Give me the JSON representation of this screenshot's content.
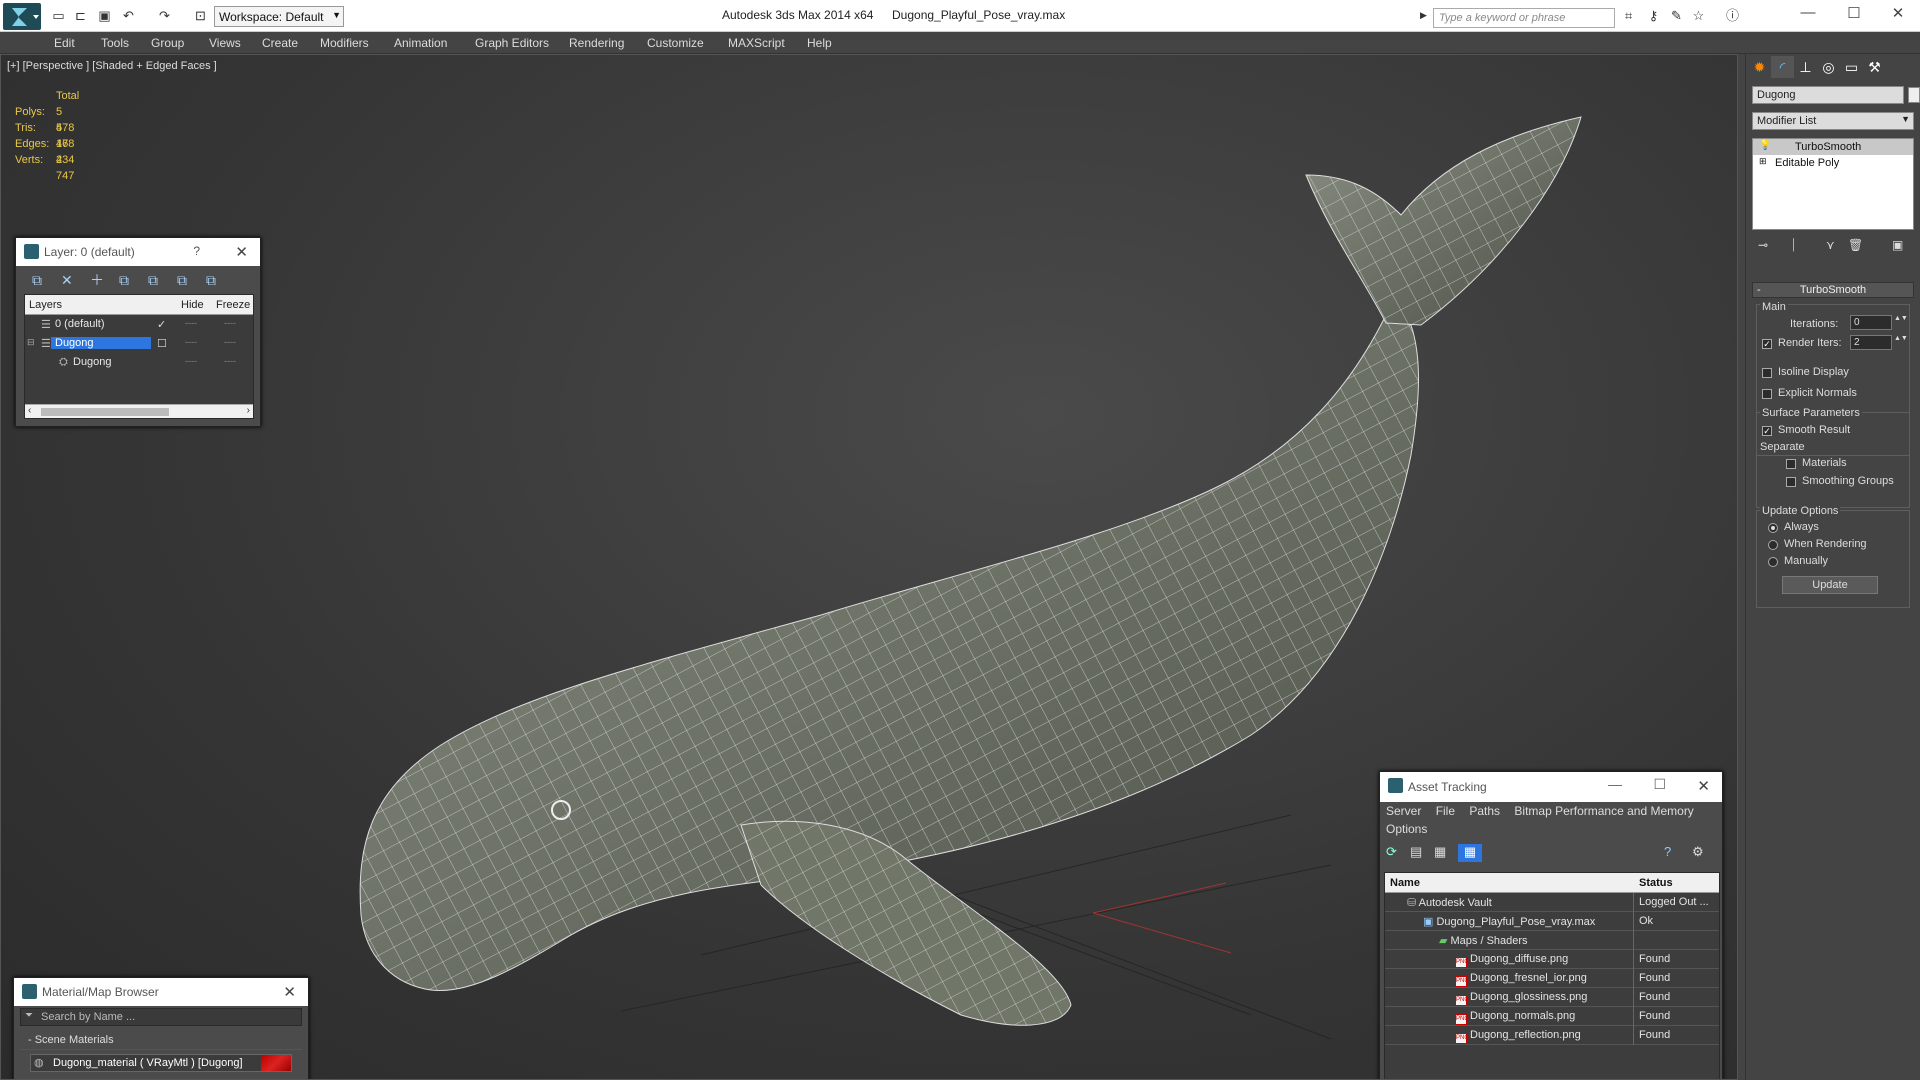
{
  "titlebar": {
    "app_title": "Autodesk 3ds Max  2014 x64",
    "file_title": "Dugong_Playful_Pose_vray.max",
    "workspace_label": "Workspace: Default",
    "search_placeholder": "Type a keyword or phrase"
  },
  "menus": [
    "Edit",
    "Tools",
    "Group",
    "Views",
    "Create",
    "Modifiers",
    "Animation",
    "Graph Editors",
    "Rendering",
    "Customize",
    "MAXScript",
    "Help"
  ],
  "viewport": {
    "label": "[+] [Perspective ] [Shaded + Edged Faces ]",
    "stats": {
      "header": "Total",
      "polys_label": "Polys:",
      "polys": "5 478",
      "tris_label": "Tris:",
      "tris": "5 478",
      "edges_label": "Edges:",
      "edges": "16 434",
      "verts_label": "Verts:",
      "verts": "2 747"
    }
  },
  "layer_panel": {
    "title": "Layer: 0 (default)",
    "help": "?",
    "col_layers": "Layers",
    "col_hide": "Hide",
    "col_freeze": "Freeze",
    "rows": [
      {
        "name": "0 (default)",
        "dashes_hide": "----",
        "dashes_freeze": "----"
      },
      {
        "name": "Dugong",
        "dashes_hide": "----",
        "dashes_freeze": "----"
      },
      {
        "name": "Dugong",
        "dashes_hide": "----",
        "dashes_freeze": "----"
      }
    ]
  },
  "material_browser": {
    "title": "Material/Map Browser",
    "search_placeholder": "Search by Name ...",
    "section": "- Scene Materials",
    "item": "Dugong_material  ( VRayMtl ) [Dugong]"
  },
  "asset_tracking": {
    "title": "Asset Tracking",
    "menus": [
      "Server",
      "File",
      "Paths",
      "Bitmap Performance and Memory"
    ],
    "menu_options": "Options",
    "col_name": "Name",
    "col_status": "Status",
    "rows": [
      {
        "name": "Autodesk Vault",
        "status": "Logged Out ..."
      },
      {
        "name": "Dugong_Playful_Pose_vray.max",
        "status": "Ok"
      },
      {
        "name": "Maps / Shaders",
        "status": ""
      },
      {
        "name": "Dugong_diffuse.png",
        "status": "Found"
      },
      {
        "name": "Dugong_fresnel_ior.png",
        "status": "Found"
      },
      {
        "name": "Dugong_glossiness.png",
        "status": "Found"
      },
      {
        "name": "Dugong_normals.png",
        "status": "Found"
      },
      {
        "name": "Dugong_reflection.png",
        "status": "Found"
      }
    ]
  },
  "command_panel": {
    "object_name": "Dugong",
    "modifier_list": "Modifier List",
    "stack": [
      "TurboSmooth",
      "Editable Poly"
    ],
    "rollout_title": "TurboSmooth",
    "main_label": "Main",
    "iterations_label": "Iterations:",
    "iterations_value": "0",
    "render_iters_label": "Render Iters:",
    "render_iters_value": "2",
    "isoline_label": "Isoline Display",
    "explicit_normals_label": "Explicit Normals",
    "surface_params_label": "Surface Parameters",
    "smooth_result_label": "Smooth Result",
    "separate_label": "Separate",
    "materials_label": "Materials",
    "smoothing_groups_label": "Smoothing Groups",
    "update_options_label": "Update Options",
    "always_label": "Always",
    "when_rendering_label": "When Rendering",
    "manually_label": "Manually",
    "update_button": "Update"
  }
}
